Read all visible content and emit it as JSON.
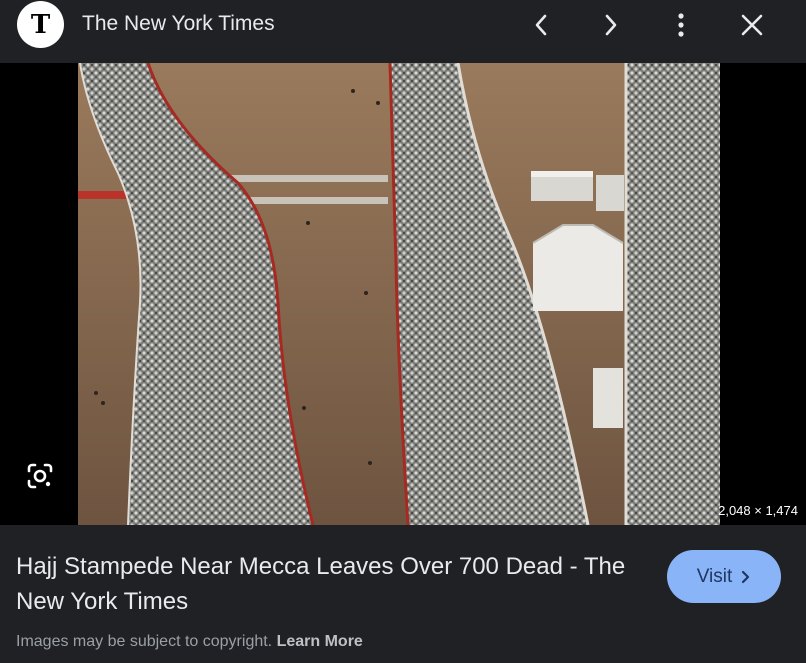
{
  "header": {
    "logo_letter": "T",
    "source": "The New York Times",
    "icons": [
      "chevron-left-icon",
      "chevron-right-icon",
      "more-vert-icon",
      "close-icon"
    ]
  },
  "image": {
    "dimensions": "2,048 × 1,474",
    "lens_icon": "google-lens-icon"
  },
  "caption": {
    "title": "Hajj Stampede Near Mecca Leaves Over 700 Dead - The New York Times"
  },
  "visit_button": {
    "label": "Visit"
  },
  "footer": {
    "notice": "Images may be subject to copyright.",
    "learn_more": "Learn More"
  },
  "colors": {
    "background": "#202124",
    "accent": "#8ab4f8",
    "text": "#e8eaed",
    "muted": "#9aa0a6"
  }
}
